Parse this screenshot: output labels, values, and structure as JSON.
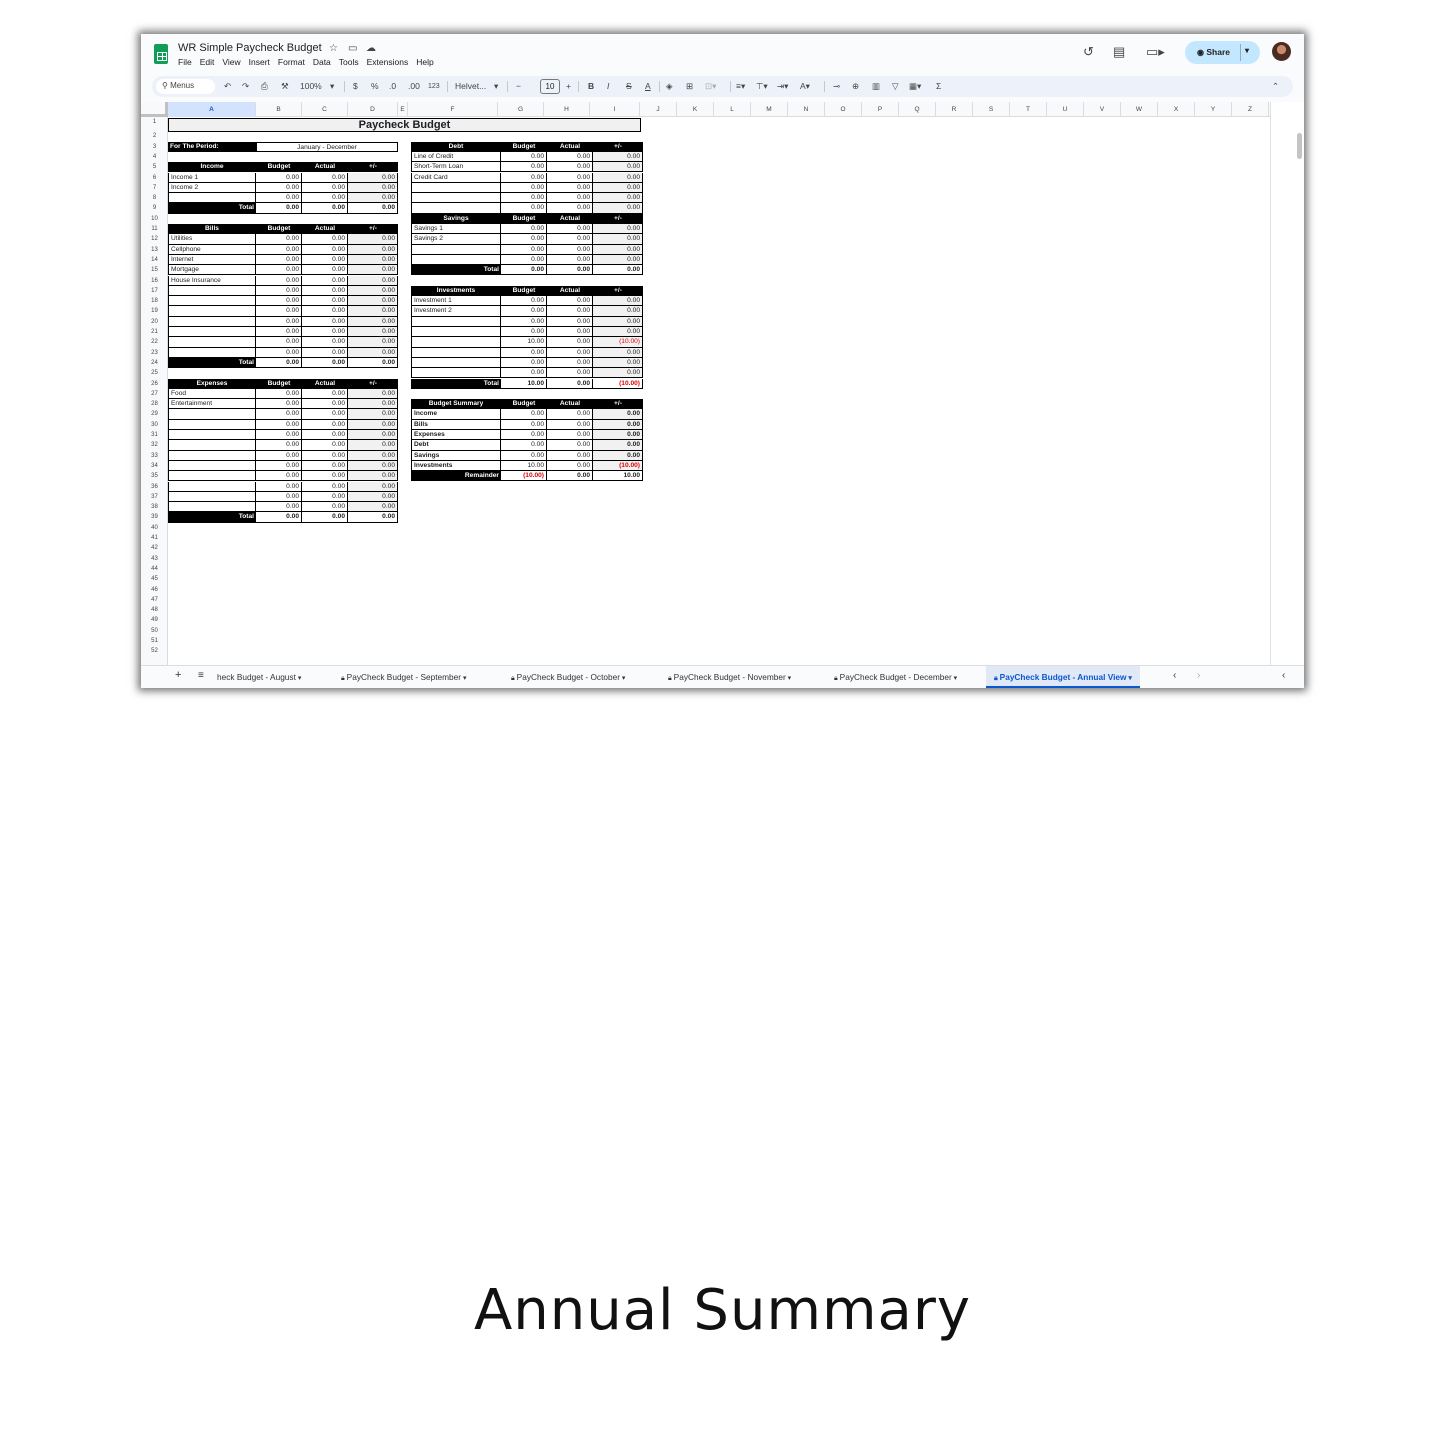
{
  "header": {
    "doc_title": "WR Simple Paycheck Budget",
    "menu": [
      "File",
      "Edit",
      "View",
      "Insert",
      "Format",
      "Data",
      "Tools",
      "Extensions",
      "Help"
    ],
    "share_label": "Share"
  },
  "toolbar": {
    "search_label": "Menus",
    "zoom": "100%",
    "currency": "$",
    "percent": "%",
    "dec_dec": ".0",
    "dec_inc": ".00",
    "num_format": "123",
    "font": "Helvet...",
    "font_size": "10",
    "bold": "B",
    "italic": "I",
    "strike": "S",
    "text_color": "A",
    "sum": "Σ"
  },
  "columns": [
    "A",
    "B",
    "C",
    "D",
    "E",
    "F",
    "G",
    "H",
    "I",
    "J",
    "K",
    "L",
    "M",
    "N",
    "O",
    "P",
    "Q",
    "R",
    "S",
    "T",
    "U",
    "V",
    "W",
    "X",
    "Y",
    "Z"
  ],
  "sheet": {
    "title": "Paycheck Budget",
    "period_label": "For The Period:",
    "period_value": "January - December",
    "col_labels": {
      "budget": "Budget",
      "actual": "Actual",
      "diff": "+/-"
    },
    "total_label": "Total",
    "income": {
      "title": "Income",
      "rows": [
        [
          "Income 1",
          "0.00",
          "0.00",
          "0.00"
        ],
        [
          "Income 2",
          "0.00",
          "0.00",
          "0.00"
        ],
        [
          "",
          "0.00",
          "0.00",
          "0.00"
        ]
      ],
      "total": [
        "0.00",
        "0.00",
        "0.00"
      ]
    },
    "bills": {
      "title": "Bills",
      "rows": [
        [
          "Utilities",
          "0.00",
          "0.00",
          "0.00"
        ],
        [
          "Cellphone",
          "0.00",
          "0.00",
          "0.00"
        ],
        [
          "Internet",
          "0.00",
          "0.00",
          "0.00"
        ],
        [
          "Mortgage",
          "0.00",
          "0.00",
          "0.00"
        ],
        [
          "House Insurance",
          "0.00",
          "0.00",
          "0.00"
        ],
        [
          "",
          "0.00",
          "0.00",
          "0.00"
        ],
        [
          "",
          "0.00",
          "0.00",
          "0.00"
        ],
        [
          "",
          "0.00",
          "0.00",
          "0.00"
        ],
        [
          "",
          "0.00",
          "0.00",
          "0.00"
        ],
        [
          "",
          "0.00",
          "0.00",
          "0.00"
        ],
        [
          "",
          "0.00",
          "0.00",
          "0.00"
        ],
        [
          "",
          "0.00",
          "0.00",
          "0.00"
        ]
      ],
      "total": [
        "0.00",
        "0.00",
        "0.00"
      ]
    },
    "expenses": {
      "title": "Expenses",
      "rows": [
        [
          "Food",
          "0.00",
          "0.00",
          "0.00"
        ],
        [
          "Entertainment",
          "0.00",
          "0.00",
          "0.00"
        ],
        [
          "",
          "0.00",
          "0.00",
          "0.00"
        ],
        [
          "",
          "0.00",
          "0.00",
          "0.00"
        ],
        [
          "",
          "0.00",
          "0.00",
          "0.00"
        ],
        [
          "",
          "0.00",
          "0.00",
          "0.00"
        ],
        [
          "",
          "0.00",
          "0.00",
          "0.00"
        ],
        [
          "",
          "0.00",
          "0.00",
          "0.00"
        ],
        [
          "",
          "0.00",
          "0.00",
          "0.00"
        ],
        [
          "",
          "0.00",
          "0.00",
          "0.00"
        ],
        [
          "",
          "0.00",
          "0.00",
          "0.00"
        ],
        [
          "",
          "0.00",
          "0.00",
          "0.00"
        ]
      ],
      "total": [
        "0.00",
        "0.00",
        "0.00"
      ]
    },
    "debt": {
      "title": "Debt",
      "rows": [
        [
          "Line of Credit",
          "0.00",
          "0.00",
          "0.00"
        ],
        [
          "Short-Term Loan",
          "0.00",
          "0.00",
          "0.00"
        ],
        [
          "Credit Card",
          "0.00",
          "0.00",
          "0.00"
        ],
        [
          "",
          "0.00",
          "0.00",
          "0.00"
        ],
        [
          "",
          "0.00",
          "0.00",
          "0.00"
        ],
        [
          "",
          "0.00",
          "0.00",
          "0.00"
        ],
        [
          "",
          "0.00",
          "0.00",
          "0.00"
        ],
        [
          "",
          "0.00",
          "0.00",
          "0.00"
        ]
      ],
      "total": [
        "0.00",
        "0.00",
        "0.00"
      ]
    },
    "savings": {
      "title": "Savings",
      "rows": [
        [
          "Savings 1",
          "0.00",
          "0.00",
          "0.00"
        ],
        [
          "Savings 2",
          "0.00",
          "0.00",
          "0.00"
        ],
        [
          "",
          "0.00",
          "0.00",
          "0.00"
        ],
        [
          "",
          "0.00",
          "0.00",
          "0.00"
        ]
      ],
      "total": [
        "0.00",
        "0.00",
        "0.00"
      ]
    },
    "investments": {
      "title": "Investments",
      "rows": [
        [
          "Investment 1",
          "0.00",
          "0.00",
          "0.00"
        ],
        [
          "Investment 2",
          "0.00",
          "0.00",
          "0.00"
        ],
        [
          "",
          "0.00",
          "0.00",
          "0.00"
        ],
        [
          "",
          "0.00",
          "0.00",
          "0.00"
        ],
        [
          "",
          "10.00",
          "0.00",
          "(10.00)"
        ],
        [
          "",
          "0.00",
          "0.00",
          "0.00"
        ],
        [
          "",
          "0.00",
          "0.00",
          "0.00"
        ],
        [
          "",
          "0.00",
          "0.00",
          "0.00"
        ]
      ],
      "total": [
        "10.00",
        "0.00",
        "(10.00)"
      ]
    },
    "summary": {
      "title": "Budget Summary",
      "rows": [
        [
          "Income",
          "0.00",
          "0.00",
          "0.00"
        ],
        [
          "Bills",
          "0.00",
          "0.00",
          "0.00"
        ],
        [
          "Expenses",
          "0.00",
          "0.00",
          "0.00"
        ],
        [
          "Debt",
          "0.00",
          "0.00",
          "0.00"
        ],
        [
          "Savings",
          "0.00",
          "0.00",
          "0.00"
        ],
        [
          "Investments",
          "10.00",
          "0.00",
          "(10.00)"
        ]
      ],
      "remainder_label": "Remainder",
      "remainder": [
        "(10.00)",
        "0.00",
        "10.00"
      ]
    }
  },
  "tabs": [
    {
      "label": "heck Budget - August",
      "locked": false,
      "active": false
    },
    {
      "label": "PayCheck Budget - September",
      "locked": true,
      "active": false
    },
    {
      "label": "PayCheck Budget - October",
      "locked": true,
      "active": false
    },
    {
      "label": "PayCheck Budget - November",
      "locked": true,
      "active": false
    },
    {
      "label": "PayCheck Budget - December",
      "locked": true,
      "active": false
    },
    {
      "label": "PayCheck Budget - Annual View",
      "locked": true,
      "active": true
    }
  ],
  "caption": "Annual Summary",
  "colors": {
    "negative": "#dd0000",
    "active_tab": "#0b57d0",
    "share_bg": "#c2e7ff"
  }
}
